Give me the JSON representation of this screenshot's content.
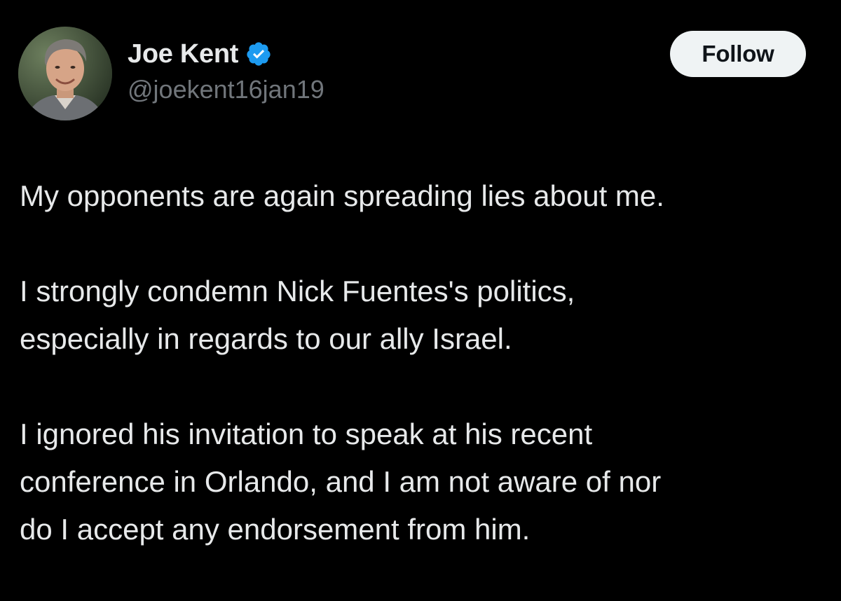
{
  "author": {
    "display_name": "Joe Kent",
    "handle": "@joekent16jan19",
    "verified_icon": "verified-badge-icon",
    "verified_color": "#1d9bf0"
  },
  "follow_button": {
    "label": "Follow"
  },
  "tweet": {
    "paragraphs": [
      [
        "My opponents are again spreading lies about me."
      ],
      [
        "I strongly condemn Nick Fuentes's politics,",
        "especially in regards to our ally Israel."
      ],
      [
        "I ignored his invitation to speak at his recent",
        "conference in Orlando, and I am not aware of nor",
        "do I accept any endorsement from him."
      ]
    ]
  },
  "colors": {
    "background": "#000000",
    "text_primary": "#e7e9ea",
    "text_secondary": "#71767b",
    "button_bg": "#eff3f4",
    "button_text": "#0f1419"
  }
}
